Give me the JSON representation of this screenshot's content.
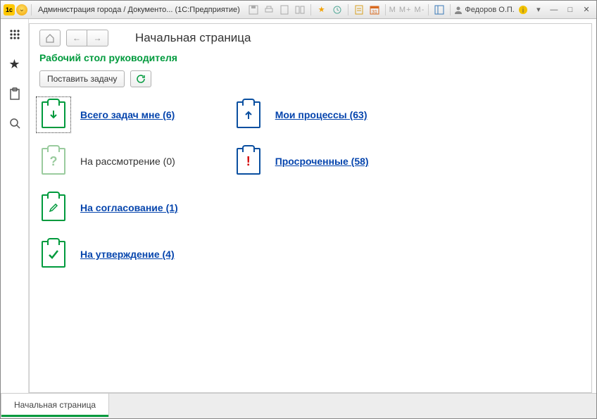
{
  "titlebar": {
    "app_icon_text": "1c",
    "title": "Администрация города / Документо... (1С:Предприятие)",
    "mem_label": "M M+ M-",
    "user": "Федоров О.П."
  },
  "sidebar": {},
  "page": {
    "nav_title": "Начальная страница",
    "section_title": "Рабочий стол руководителя",
    "set_task_button": "Поставить задачу"
  },
  "tasks": {
    "left": [
      {
        "label": "Всего задач мне (6)",
        "link": true,
        "icon": "down",
        "color": "green",
        "selected": true
      },
      {
        "label": "На рассмотрение (0)",
        "link": false,
        "icon": "question",
        "color": "green-light",
        "selected": false
      },
      {
        "label": "На согласование (1)",
        "link": true,
        "icon": "pencil",
        "color": "green",
        "selected": false
      },
      {
        "label": "На утверждение (4)",
        "link": true,
        "icon": "check",
        "color": "green",
        "selected": false
      }
    ],
    "right": [
      {
        "label": "Мои процессы (63)",
        "link": true,
        "icon": "up",
        "color": "blue",
        "selected": false
      },
      {
        "label": "Просроченные (58)",
        "link": true,
        "icon": "alert",
        "color": "alert",
        "selected": false
      }
    ]
  },
  "tabs": {
    "active": "Начальная страница"
  }
}
